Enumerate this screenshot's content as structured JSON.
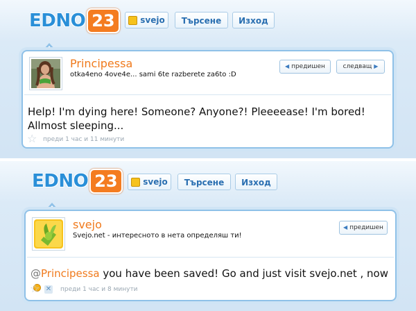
{
  "header1": {
    "logo_text": "EDNO",
    "logo_num": "23",
    "user_label": "svejo",
    "search_label": "Търсене",
    "logout_label": "Изход"
  },
  "header2": {
    "logo_text": "EDNO",
    "logo_num": "23",
    "user_label": "svejo",
    "search_label": "Търсене",
    "logout_label": "Изход"
  },
  "post1": {
    "username": "Principessa",
    "bio": "otka4eno 4ove4e... sami 6te razberete za6to :D",
    "prev_label": "предишен",
    "next_label": "следващ",
    "text": "Help! I'm dying here! Someone? Anyone?! Pleeeease! I'm bored! Allmost sleeping...",
    "meta": "преди 1 час и 11 минути",
    "icons": {
      "prev": "arrow-left-icon",
      "next": "arrow-right-icon",
      "favorite": "star-icon"
    }
  },
  "post2": {
    "username": "svejo",
    "bio": "Svejo.net - интересното в нета определяш ти!",
    "prev_label": "предишен",
    "mention_at": "@",
    "mention_name": "Principessa",
    "text": " you have been saved! Go and just visit svejo.net , now",
    "meta": "преди 1 час и 8 минути",
    "icons": {
      "prev": "arrow-left-icon",
      "favorite": "star-icon",
      "delete": "close-icon",
      "emoji": "smiley-icon"
    }
  },
  "colors": {
    "accent": "#f07a1c",
    "link": "#2a6fb1",
    "border": "#8fc1e8"
  }
}
